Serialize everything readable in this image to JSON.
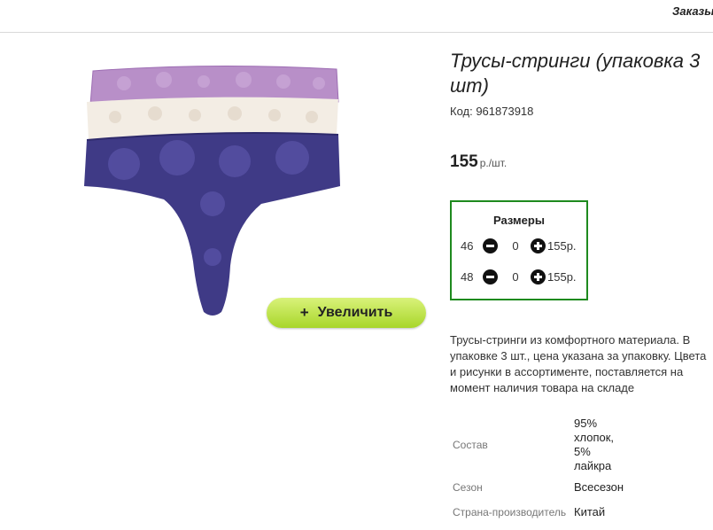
{
  "header": {
    "orders_link": "Заказы"
  },
  "product": {
    "title": "Трусы-стринги (упаковка 3\nшт)",
    "sku": "Код: 961873918",
    "price": "155",
    "price_unit": "р./шт.",
    "zoom_button": {
      "icon": "+",
      "label": "Увеличить"
    },
    "sizes_title": "Размеры",
    "sizes": [
      {
        "size": "46",
        "qty": "0",
        "price": "155р."
      },
      {
        "size": "48",
        "qty": "0",
        "price": "155р."
      }
    ],
    "description": "Трусы-стринги из комфортного материала. В упаковке 3 шт., цена указана за упаковку. Цвета и рисунки в ассортименте, поставляется на момент наличия товара на складе",
    "attributes": [
      {
        "label": "Состав",
        "value": "95%\nхлопок,\n5%\nлайкра"
      },
      {
        "label": "Сезон",
        "value": "Всесезон"
      },
      {
        "label": "Страна-производитель",
        "value": "Китай"
      }
    ]
  },
  "colors": {
    "sizes_border": "#1e8a1e",
    "zoom_button": "#b8e03c"
  }
}
